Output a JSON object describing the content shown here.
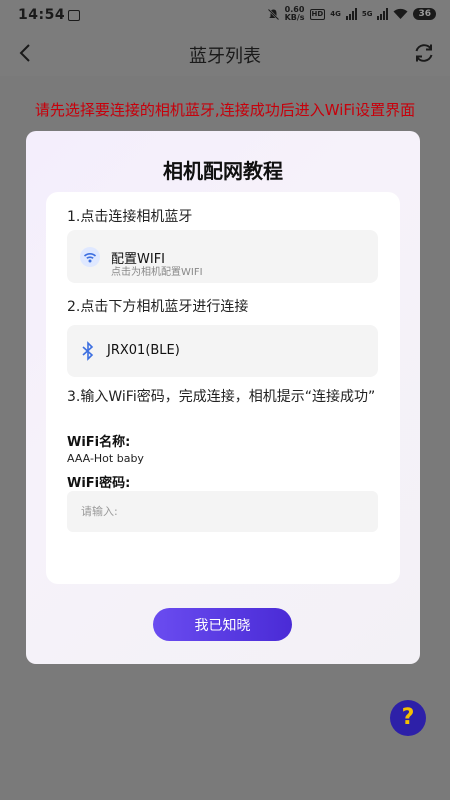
{
  "status_bar": {
    "time": "14:54",
    "speed_value": "0.60",
    "speed_unit": "KB/s",
    "hd_badge": "HD",
    "net1": "4G",
    "net2": "5G",
    "battery": "36"
  },
  "header": {
    "title": "蓝牙列表"
  },
  "warning_text": "请先选择要连接的相机蓝牙,连接成功后进入WiFi设置界面",
  "modal": {
    "title": "相机配网教程",
    "step1": "1.点击连接相机蓝牙",
    "wifi_config": {
      "title": "配置WIFI",
      "subtitle": "点击为相机配置WIFI"
    },
    "step2": "2.点击下方相机蓝牙进行连接",
    "device_name": "JRX01(BLE)",
    "step3": "3.输入WiFi密码，完成连接，相机提示“连接成功”",
    "wifi_name_label": "WiFi名称:",
    "wifi_name_value": "AAA-Hot baby",
    "wifi_pwd_label": "WiFi密码:",
    "pwd_placeholder": "请输入:",
    "confirm_label": "我已知晓"
  },
  "help_button": "?",
  "colors": {
    "accent": "#5a3ce6",
    "warning": "#c7000b",
    "help_fab_bg": "#2d20a8",
    "help_fab_fg": "#f5c000"
  }
}
